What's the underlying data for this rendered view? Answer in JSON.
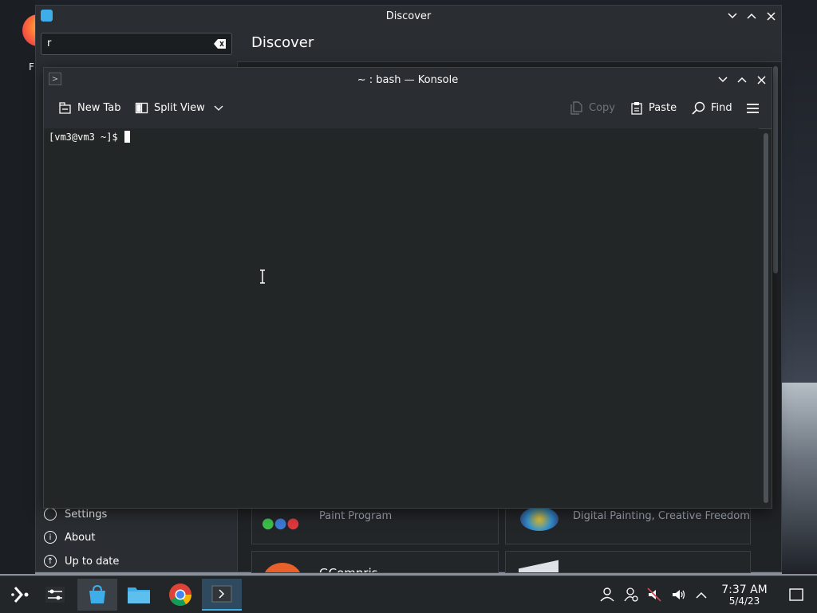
{
  "desktop": {
    "firefox_label_fragment": "F"
  },
  "discover": {
    "window_title": "Discover",
    "search_value": "r",
    "page_title": "Discover",
    "sidebar_items": [
      {
        "label": "Settings",
        "icon": "settings-icon"
      },
      {
        "label": "About",
        "icon": "info-icon"
      },
      {
        "label": "Up to date",
        "icon": "up-arrow-icon"
      }
    ],
    "cards": [
      {
        "desc": "Paint Program"
      },
      {
        "desc": "Digital Painting, Creative Freedom"
      },
      {
        "name": "GCompris"
      },
      {
        "name": ""
      }
    ]
  },
  "konsole": {
    "window_title": "~ : bash — Konsole",
    "toolbar": {
      "new_tab": "New Tab",
      "split_view": "Split View",
      "copy": "Copy",
      "paste": "Paste",
      "find": "Find"
    },
    "prompt": "[vm3@vm3 ~]$"
  },
  "taskbar": {
    "time": "7:37 AM",
    "date": "5/4/23",
    "apps": [
      "application-launcher",
      "system-settings",
      "discover",
      "dolphin-files",
      "google-chrome",
      "konsole"
    ],
    "tray": [
      "user-icon",
      "network-icon",
      "audio-muted-icon",
      "volume-icon",
      "tray-expand-icon"
    ]
  },
  "colors": {
    "accent": "#3daee9",
    "window_bg": "#232627",
    "panel_bg": "#2a2e32"
  }
}
